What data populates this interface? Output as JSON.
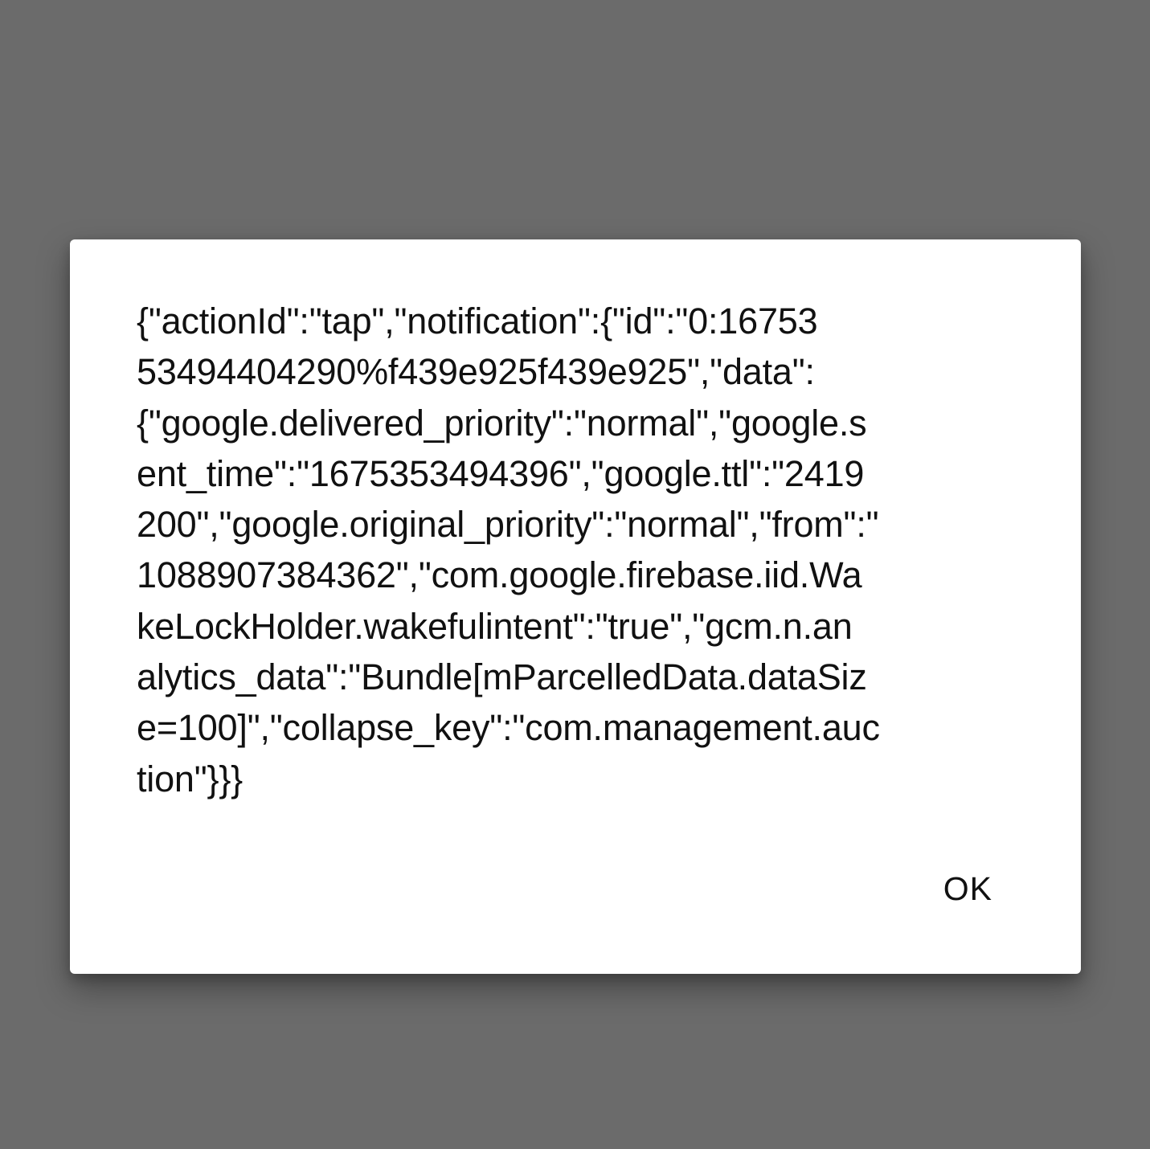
{
  "dialog": {
    "message_lines": [
      "{\"actionId\":\"tap\",\"notification\":{\"id\":\"0:16753",
      "53494404290%f439e925f439e925\",\"data\":",
      "{\"google.delivered_priority\":\"normal\",\"google.s",
      "ent_time\":\"1675353494396\",\"google.ttl\":\"2419",
      "200\",\"google.original_priority\":\"normal\",\"from\":\"",
      "1088907384362\",\"com.google.firebase.iid.Wa",
      "keLockHolder.wakefulintent\":\"true\",\"gcm.n.an",
      "alytics_data\":\"Bundle[mParcelledData.dataSiz",
      "e=100]\",\"collapse_key\":\"com.management.auc",
      "tion\"}}}"
    ],
    "ok_label": "OK"
  },
  "colors": {
    "scrim": "#6b6b6b",
    "dialog_background": "#ffffff",
    "text": "#111111"
  }
}
